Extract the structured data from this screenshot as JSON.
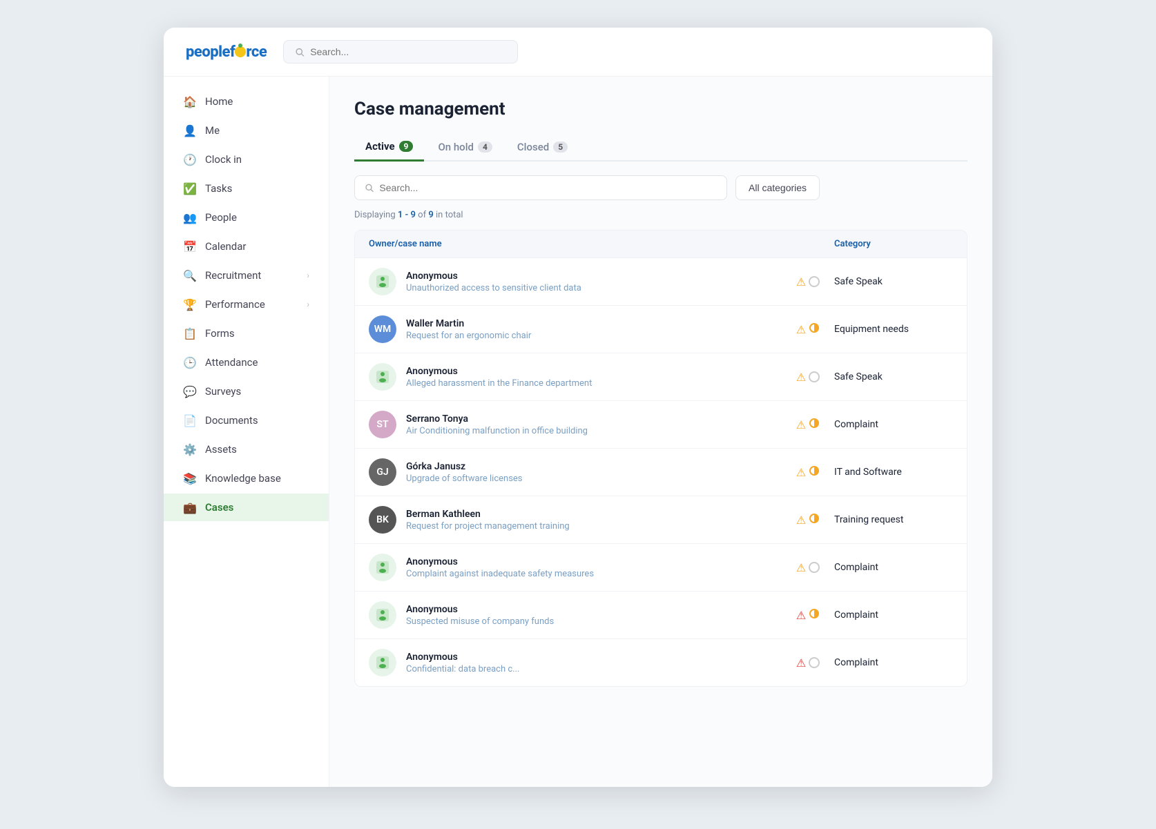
{
  "app": {
    "title": "PeopleForce"
  },
  "topbar": {
    "search_placeholder": "Search..."
  },
  "sidebar": {
    "items": [
      {
        "id": "home",
        "label": "Home",
        "icon": "🏠",
        "hasArrow": false,
        "active": false
      },
      {
        "id": "me",
        "label": "Me",
        "icon": "👤",
        "hasArrow": false,
        "active": false
      },
      {
        "id": "clock-in",
        "label": "Clock in",
        "icon": "🕐",
        "hasArrow": false,
        "active": false
      },
      {
        "id": "tasks",
        "label": "Tasks",
        "icon": "✅",
        "hasArrow": false,
        "active": false
      },
      {
        "id": "people",
        "label": "People",
        "icon": "👥",
        "hasArrow": false,
        "active": false
      },
      {
        "id": "calendar",
        "label": "Calendar",
        "icon": "📅",
        "hasArrow": false,
        "active": false
      },
      {
        "id": "recruitment",
        "label": "Recruitment",
        "icon": "🔍",
        "hasArrow": true,
        "active": false
      },
      {
        "id": "performance",
        "label": "Performance",
        "icon": "🏆",
        "hasArrow": true,
        "active": false
      },
      {
        "id": "forms",
        "label": "Forms",
        "icon": "📋",
        "hasArrow": false,
        "active": false
      },
      {
        "id": "attendance",
        "label": "Attendance",
        "icon": "🕒",
        "hasArrow": false,
        "active": false
      },
      {
        "id": "surveys",
        "label": "Surveys",
        "icon": "💬",
        "hasArrow": false,
        "active": false
      },
      {
        "id": "documents",
        "label": "Documents",
        "icon": "📄",
        "hasArrow": false,
        "active": false
      },
      {
        "id": "assets",
        "label": "Assets",
        "icon": "⚙️",
        "hasArrow": false,
        "active": false
      },
      {
        "id": "knowledge-base",
        "label": "Knowledge base",
        "icon": "📚",
        "hasArrow": false,
        "active": false
      },
      {
        "id": "cases",
        "label": "Cases",
        "icon": "💼",
        "hasArrow": false,
        "active": true
      }
    ]
  },
  "page": {
    "title": "Case management",
    "tabs": [
      {
        "id": "active",
        "label": "Active",
        "count": "9",
        "badgeColor": "green",
        "active": true
      },
      {
        "id": "on-hold",
        "label": "On hold",
        "count": "4",
        "badgeColor": "gray",
        "active": false
      },
      {
        "id": "closed",
        "label": "Closed",
        "count": "5",
        "badgeColor": "gray",
        "active": false
      }
    ],
    "search_placeholder": "Search...",
    "category_button": "All categories",
    "displaying": "Displaying ",
    "displaying_range": "1 - 9",
    "displaying_of": " of ",
    "displaying_total": "9",
    "displaying_suffix": " in total",
    "table_headers": {
      "owner": "Owner/case name",
      "category": "Category"
    },
    "cases": [
      {
        "id": 1,
        "owner": "Anonymous",
        "case_name": "Unauthorized access to sensitive client data",
        "category": "Safe Speak",
        "avatar_type": "anon",
        "warning_level": "yellow",
        "circle_type": "empty"
      },
      {
        "id": 2,
        "owner": "Waller Martin",
        "case_name": "Request for an ergonomic chair",
        "category": "Equipment needs",
        "avatar_type": "photo",
        "avatar_color": "#5b8dd9",
        "warning_level": "yellow",
        "circle_type": "half"
      },
      {
        "id": 3,
        "owner": "Anonymous",
        "case_name": "Alleged harassment in the Finance department",
        "category": "Safe Speak",
        "avatar_type": "anon",
        "warning_level": "yellow",
        "circle_type": "empty"
      },
      {
        "id": 4,
        "owner": "Serrano Tonya",
        "case_name": "Air Conditioning malfunction in office building",
        "category": "Complaint",
        "avatar_type": "photo",
        "avatar_color": "#e8a87c",
        "warning_level": "yellow",
        "circle_type": "half"
      },
      {
        "id": 5,
        "owner": "Górka Janusz",
        "case_name": "Upgrade of software licenses",
        "category": "IT and Software",
        "avatar_type": "photo_dark",
        "avatar_color": "#888",
        "warning_level": "yellow",
        "circle_type": "half"
      },
      {
        "id": 6,
        "owner": "Berman Kathleen",
        "case_name": "Request for project management training",
        "category": "Training request",
        "avatar_type": "photo",
        "avatar_color": "#c97040",
        "warning_level": "yellow",
        "circle_type": "half"
      },
      {
        "id": 7,
        "owner": "Anonymous",
        "case_name": "Complaint against inadequate safety measures",
        "category": "Complaint",
        "avatar_type": "anon",
        "warning_level": "yellow",
        "circle_type": "empty"
      },
      {
        "id": 8,
        "owner": "Anonymous",
        "case_name": "Suspected misuse of company funds",
        "category": "Complaint",
        "avatar_type": "anon",
        "warning_level": "red",
        "circle_type": "half"
      },
      {
        "id": 9,
        "owner": "Anonymous",
        "case_name": "Confidential: data breach c...",
        "category": "Complaint",
        "avatar_type": "anon",
        "warning_level": "red",
        "circle_type": "empty"
      }
    ]
  }
}
